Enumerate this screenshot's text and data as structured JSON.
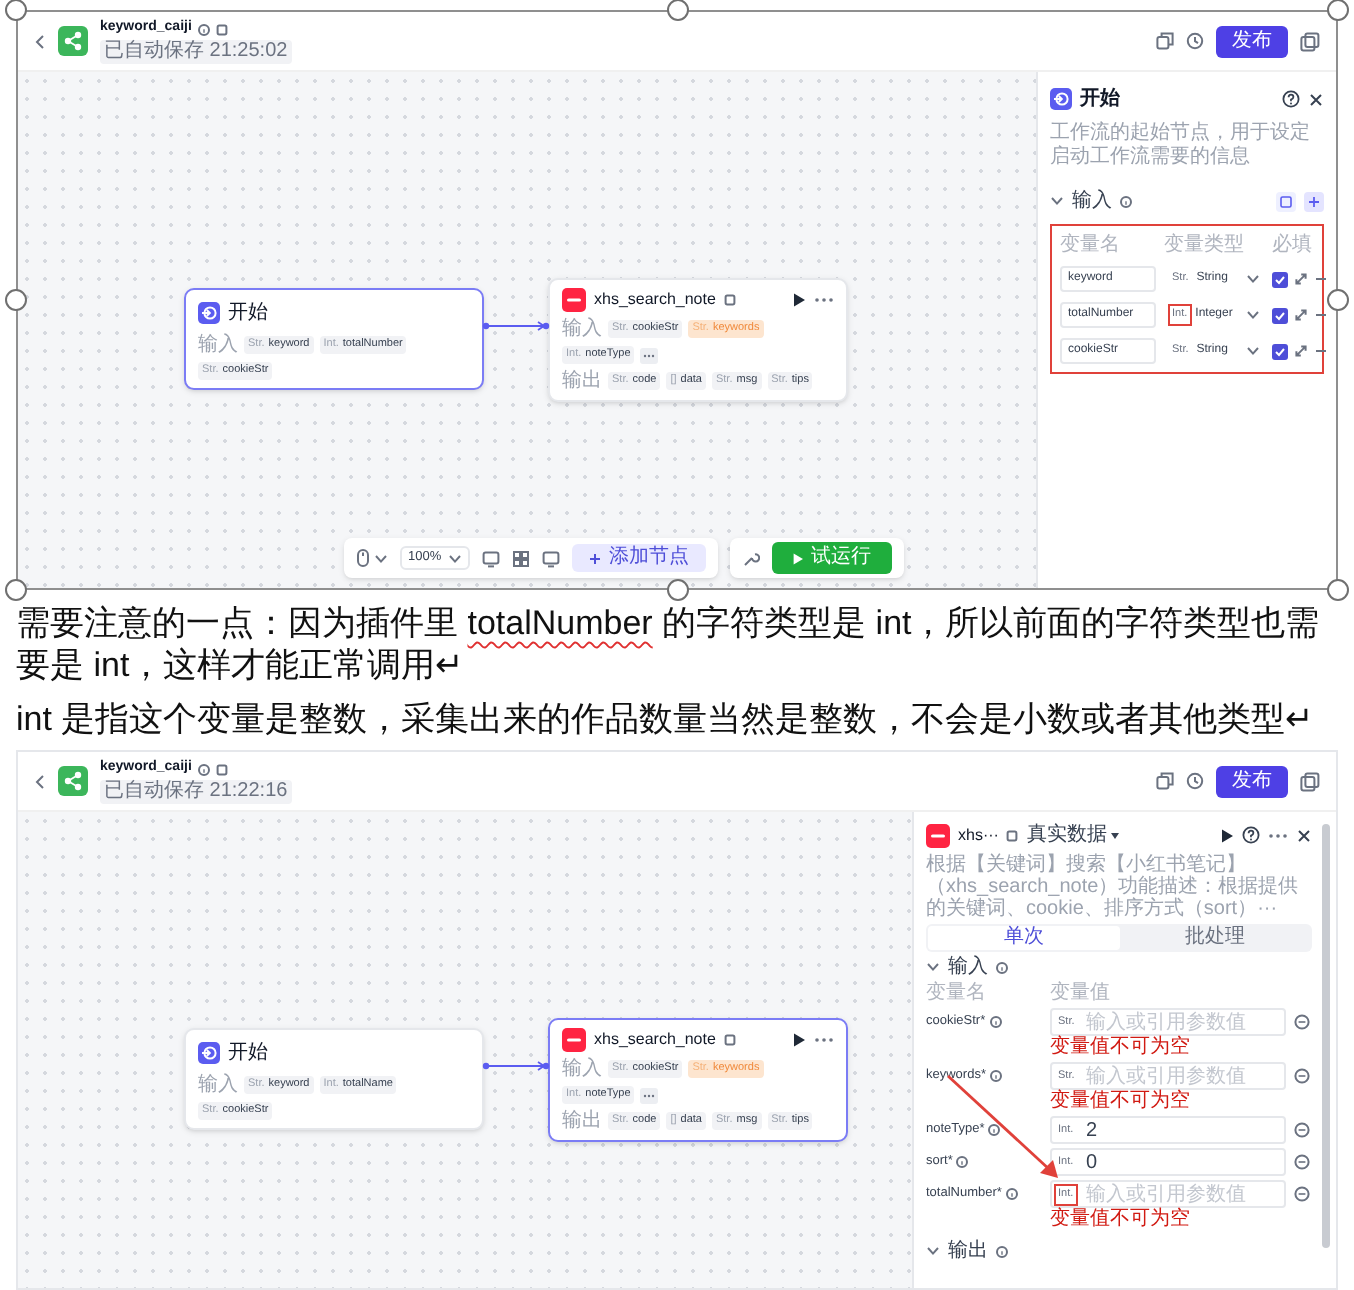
{
  "document": [
    {
      "kind": "screenshot",
      "selected": true,
      "header": {
        "title": "keyword_caiji",
        "saved": "已自动保存 21:25:02",
        "publish": "发布"
      },
      "nodes": [
        {
          "kind": "start",
          "selected": true,
          "title": "开始",
          "rows": [
            {
              "label": "输入",
              "more": false,
              "chips": [
                {
                  "tag": "Str.",
                  "name": "keyword",
                  "warning": false
                },
                {
                  "tag": "Int.",
                  "name": "totalNumber",
                  "warning": false
                },
                {
                  "tag": "Str.",
                  "name": "cookieStr",
                  "warning": false
                }
              ]
            }
          ]
        },
        {
          "kind": "plugin",
          "selected": false,
          "title": "xhs_search_note",
          "rows": [
            {
              "label": "输入",
              "more": true,
              "chips": [
                {
                  "tag": "Str.",
                  "name": "cookieStr",
                  "warning": false
                },
                {
                  "tag": "Str.",
                  "name": "keywords",
                  "warning": true
                },
                {
                  "tag": "Int.",
                  "name": "noteType",
                  "warning": false
                }
              ]
            },
            {
              "label": "输出",
              "more": false,
              "chips": [
                {
                  "tag": "Str.",
                  "name": "code",
                  "warning": false
                },
                {
                  "tag": "[]",
                  "name": "data",
                  "warning": false
                },
                {
                  "tag": "Str.",
                  "name": "msg",
                  "warning": false
                },
                {
                  "tag": "Str.",
                  "name": "tips",
                  "warning": false
                }
              ]
            }
          ]
        }
      ],
      "toolbar": {
        "zoom": "100%",
        "add_node": "添加节点",
        "test_run": "试运行"
      },
      "panel": {
        "kind": "start",
        "title": "开始",
        "description": "工作流的起始节点，用于设定启动工作流需要的信息",
        "section": "输入",
        "highlighted": true,
        "columns": [
          "变量名",
          "变量类型",
          "必填"
        ],
        "rows": [
          {
            "name": "keyword",
            "tag": "Str.",
            "type": "String",
            "required": true,
            "highlighted": false
          },
          {
            "name": "totalNumber",
            "tag": "Int.",
            "type": "Integer",
            "required": true,
            "highlighted": true
          },
          {
            "name": "cookieStr",
            "tag": "Str.",
            "type": "String",
            "required": true,
            "highlighted": false
          }
        ]
      }
    },
    {
      "kind": "paragraph",
      "segments": [
        {
          "text": "需要注意的一点：因为插件里 ",
          "spelling_error": false
        },
        {
          "text": "totalNumber",
          "spelling_error": true
        },
        {
          "text": " 的字符类型是 int，所以前面的字符类型也需要是 int，这样才能正常调用↵",
          "spelling_error": false
        }
      ]
    },
    {
      "kind": "paragraph",
      "segments": [
        {
          "text": "int 是指这个变量是整数，采集出来的作品数量当然是整数，不会是小数或者其他类型↵",
          "spelling_error": false
        }
      ]
    },
    {
      "kind": "screenshot",
      "selected": false,
      "header": {
        "title": "keyword_caiji",
        "saved": "已自动保存 21:22:16",
        "publish": "发布"
      },
      "nodes": [
        {
          "kind": "start",
          "selected": false,
          "title": "开始",
          "rows": [
            {
              "label": "输入",
              "more": false,
              "chips": [
                {
                  "tag": "Str.",
                  "name": "keyword",
                  "warning": false
                },
                {
                  "tag": "Int.",
                  "name": "totalName",
                  "warning": false
                },
                {
                  "tag": "Str.",
                  "name": "cookieStr",
                  "warning": false
                }
              ]
            }
          ]
        },
        {
          "kind": "plugin",
          "selected": true,
          "title": "xhs_search_note",
          "rows": [
            {
              "label": "输入",
              "more": true,
              "chips": [
                {
                  "tag": "Str.",
                  "name": "cookieStr",
                  "warning": false
                },
                {
                  "tag": "Str.",
                  "name": "keywords",
                  "warning": true
                },
                {
                  "tag": "Int.",
                  "name": "noteType",
                  "warning": false
                }
              ]
            },
            {
              "label": "输出",
              "more": false,
              "chips": [
                {
                  "tag": "Str.",
                  "name": "code",
                  "warning": false
                },
                {
                  "tag": "[]",
                  "name": "data",
                  "warning": false
                },
                {
                  "tag": "Str.",
                  "name": "msg",
                  "warning": false
                },
                {
                  "tag": "Str.",
                  "name": "tips",
                  "warning": false
                }
              ]
            }
          ]
        }
      ],
      "panel": {
        "kind": "plugin",
        "title": "xhs···",
        "mode": "真实数据",
        "description": "根据【关键词】搜索【小红书笔记】（xhs_search_note）功能描述：根据提供的关键词、cookie、排序方式（sort）···",
        "tabs": [
          {
            "label": "单次",
            "selected": true
          },
          {
            "label": "批处理",
            "selected": false
          }
        ],
        "section": "输入",
        "columns": [
          "变量名",
          "变量值"
        ],
        "annotation_arrow": true,
        "rows": [
          {
            "name": "cookieStr*",
            "tag": "Str.",
            "placeholder": "输入或引用参数值",
            "error": "变量值不可为空",
            "highlighted": false
          },
          {
            "name": "keywords*",
            "tag": "Str.",
            "placeholder": "输入或引用参数值",
            "error": "变量值不可为空",
            "highlighted": false
          },
          {
            "name": "noteType*",
            "tag": "Int.",
            "value": "2",
            "highlighted": false
          },
          {
            "name": "sort*",
            "tag": "Int.",
            "value": "0",
            "highlighted": false
          },
          {
            "name": "totalNumber*",
            "tag": "Int.",
            "placeholder": "输入或引用参数值",
            "error": "变量值不可为空",
            "highlighted": true
          }
        ],
        "output_section": "输出"
      }
    }
  ]
}
